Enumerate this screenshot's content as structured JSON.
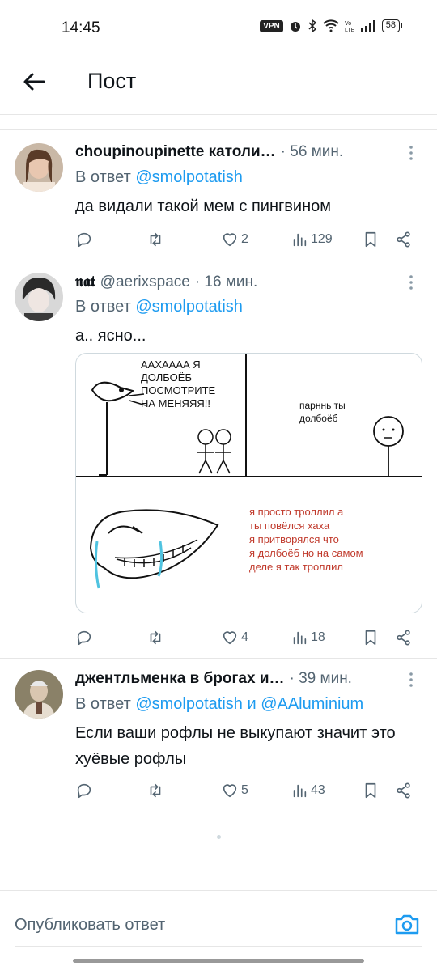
{
  "status_bar": {
    "time": "14:45",
    "vpn": "VPN",
    "battery": "58"
  },
  "header": {
    "title": "Пост",
    "back_icon": "arrow-left-icon"
  },
  "tweets": [
    {
      "name": "choupinoupinette католи…",
      "handle": "",
      "time": "· 56 мин.",
      "reply_prefix": "В ответ",
      "reply_to": "@smolpotatish",
      "reply_and": "",
      "reply_to2": "",
      "text": "да видали такой мем с пингвином",
      "likes": "2",
      "views": "129"
    },
    {
      "name": "𝖓𝖆𝖙",
      "handle": "@aerixspace",
      "time": "· 16 мин.",
      "reply_prefix": "В ответ",
      "reply_to": "@smolpotatish",
      "reply_and": "",
      "reply_to2": "",
      "text": "а.. ясно...",
      "likes": "4",
      "views": "18",
      "meme": {
        "top_left_caption": [
          "ААХАААА Я",
          "ДОЛБОЁБ",
          "ПОСМОТРИТЕ",
          "НА МЕНЯЯЯ!!"
        ],
        "top_right_caption": [
          "парннь ты",
          "долбоёб"
        ],
        "bottom_caption": [
          "я просто троллил а",
          "ты повёлся хаха",
          "я притворялся что",
          "я долбоёб но на самом",
          "деле я  так троллил"
        ],
        "bottom_caption_color": "#c0392b"
      }
    },
    {
      "name": "джентльменка в брогах и…",
      "handle": "",
      "time": "· 39 мин.",
      "reply_prefix": "В ответ",
      "reply_to": "@smolpotatish",
      "reply_and": "и",
      "reply_to2": "@AAluminium",
      "text": "Если ваши рофлы не выкупают значит это хуёвые рофлы",
      "likes": "5",
      "views": "43"
    }
  ],
  "composer": {
    "placeholder": "Опубликовать ответ",
    "camera_icon": "camera-icon"
  },
  "colors": {
    "link": "#1d9bf0",
    "secondary": "#536471",
    "text": "#0f1419"
  }
}
